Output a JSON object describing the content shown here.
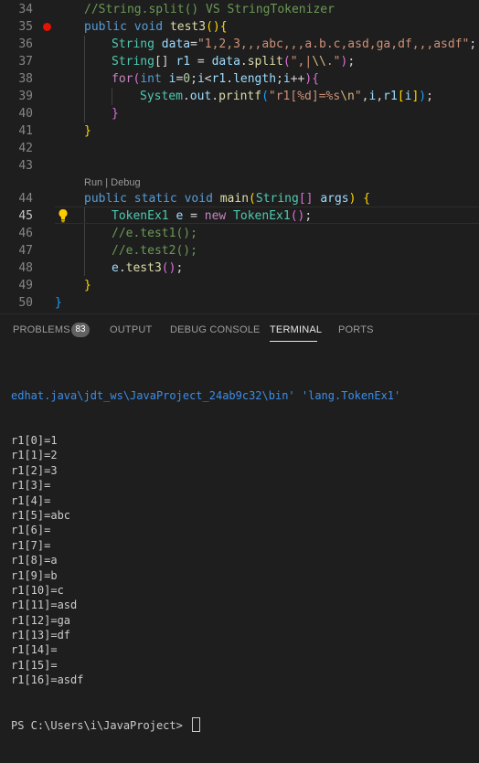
{
  "editor": {
    "codelens": "Run | Debug",
    "lines": [
      {
        "num": "34",
        "segments": [
          [
            "c-com",
            "//String.split() VS StringTokenizer"
          ]
        ]
      },
      {
        "num": "35",
        "segments": [
          [
            "c-kw",
            "public "
          ],
          [
            "c-kw",
            "void "
          ],
          [
            "c-fn",
            "test3"
          ],
          [
            "c-br1",
            "()"
          ],
          [
            "c-br1",
            "{"
          ]
        ]
      },
      {
        "num": "36",
        "segments": [
          [
            "c-ty",
            "String "
          ],
          [
            "c-var",
            "data"
          ],
          [
            "c-pun",
            "="
          ],
          [
            "c-str",
            "\"1,2,3,,,abc,,,a.b.c,asd,ga,df,,,asdf\""
          ],
          [
            "c-pun",
            ";"
          ]
        ]
      },
      {
        "num": "37",
        "segments": [
          [
            "c-ty",
            "String"
          ],
          [
            "c-pun",
            "[] "
          ],
          [
            "c-var",
            "r1"
          ],
          [
            "c-pun",
            " = "
          ],
          [
            "c-var",
            "data"
          ],
          [
            "c-pun",
            "."
          ],
          [
            "c-fn",
            "split"
          ],
          [
            "c-br2",
            "("
          ],
          [
            "c-str",
            "\",|"
          ],
          [
            "c-esc",
            "\\\\"
          ],
          [
            "c-str",
            ".\""
          ],
          [
            "c-br2",
            ")"
          ],
          [
            "c-pun",
            ";"
          ]
        ]
      },
      {
        "num": "38",
        "segments": [
          [
            "c-ctl",
            "for"
          ],
          [
            "c-br2",
            "("
          ],
          [
            "c-kw",
            "int "
          ],
          [
            "c-var",
            "i"
          ],
          [
            "c-pun",
            "="
          ],
          [
            "c-num",
            "0"
          ],
          [
            "c-pun",
            ";"
          ],
          [
            "c-var",
            "i"
          ],
          [
            "c-pun",
            "<"
          ],
          [
            "c-var",
            "r1"
          ],
          [
            "c-pun",
            "."
          ],
          [
            "c-var",
            "length"
          ],
          [
            "c-pun",
            ";"
          ],
          [
            "c-var",
            "i"
          ],
          [
            "c-pun",
            "++"
          ],
          [
            "c-br2",
            ")"
          ],
          [
            "c-br2",
            "{"
          ]
        ]
      },
      {
        "num": "39",
        "segments": [
          [
            "c-ty",
            "System"
          ],
          [
            "c-pun",
            "."
          ],
          [
            "c-var",
            "out"
          ],
          [
            "c-pun",
            "."
          ],
          [
            "c-fn",
            "printf"
          ],
          [
            "c-br3",
            "("
          ],
          [
            "c-str",
            "\"r1[%d]=%s"
          ],
          [
            "c-esc",
            "\\n"
          ],
          [
            "c-str",
            "\""
          ],
          [
            "c-pun",
            ","
          ],
          [
            "c-var",
            "i"
          ],
          [
            "c-pun",
            ","
          ],
          [
            "c-var",
            "r1"
          ],
          [
            "c-br1",
            "["
          ],
          [
            "c-var",
            "i"
          ],
          [
            "c-br1",
            "]"
          ],
          [
            "c-br3",
            ")"
          ],
          [
            "c-pun",
            ";"
          ]
        ]
      },
      {
        "num": "40",
        "segments": [
          [
            "c-br2",
            "}"
          ]
        ]
      },
      {
        "num": "41",
        "segments": [
          [
            "c-br1",
            "}"
          ]
        ]
      },
      {
        "num": "42",
        "segments": []
      },
      {
        "num": "43",
        "segments": []
      },
      {
        "num": "44",
        "segments": [
          [
            "c-kw",
            "public "
          ],
          [
            "c-kw",
            "static "
          ],
          [
            "c-kw",
            "void "
          ],
          [
            "c-fn",
            "main"
          ],
          [
            "c-br1",
            "("
          ],
          [
            "c-ty",
            "String"
          ],
          [
            "c-br2",
            "[]"
          ],
          [
            "c-var",
            " args"
          ],
          [
            "c-br1",
            ")"
          ],
          [
            "c-pun",
            " "
          ],
          [
            "c-br1",
            "{"
          ]
        ]
      },
      {
        "num": "45",
        "segments": [
          [
            "c-ty",
            "TokenEx1 "
          ],
          [
            "c-var",
            "e"
          ],
          [
            "c-pun",
            " = "
          ],
          [
            "c-ctl",
            "new "
          ],
          [
            "c-ty",
            "TokenEx1"
          ],
          [
            "c-br2",
            "()"
          ],
          [
            "c-pun",
            ";"
          ]
        ]
      },
      {
        "num": "46",
        "segments": [
          [
            "c-com",
            "//e.test1();"
          ]
        ]
      },
      {
        "num": "47",
        "segments": [
          [
            "c-com",
            "//e.test2();"
          ]
        ]
      },
      {
        "num": "48",
        "segments": [
          [
            "c-var",
            "e"
          ],
          [
            "c-pun",
            "."
          ],
          [
            "c-fn",
            "test3"
          ],
          [
            "c-br2",
            "()"
          ],
          [
            "c-pun",
            ";"
          ]
        ]
      },
      {
        "num": "49",
        "segments": [
          [
            "c-br1",
            "}"
          ]
        ]
      },
      {
        "num": "50",
        "segments": [
          [
            "c-br3",
            "}"
          ]
        ]
      }
    ]
  },
  "panel": {
    "tabs": {
      "problems": "PROBLEMS",
      "problems_count": "83",
      "output": "OUTPUT",
      "debug_console": "DEBUG CONSOLE",
      "terminal": "TERMINAL",
      "ports": "PORTS"
    },
    "terminal": {
      "path_line": "edhat.java\\jdt_ws\\JavaProject_24ab9c32\\bin' 'lang.TokenEx1'",
      "output_lines": [
        "r1[0]=1",
        "r1[1]=2",
        "r1[2]=3",
        "r1[3]=",
        "r1[4]=",
        "r1[5]=abc",
        "r1[6]=",
        "r1[7]=",
        "r1[8]=a",
        "r1[9]=b",
        "r1[10]=c",
        "r1[11]=asd",
        "r1[12]=ga",
        "r1[13]=df",
        "r1[14]=",
        "r1[15]=",
        "r1[16]=asdf"
      ],
      "prompt": "PS C:\\Users\\i\\JavaProject> "
    }
  }
}
